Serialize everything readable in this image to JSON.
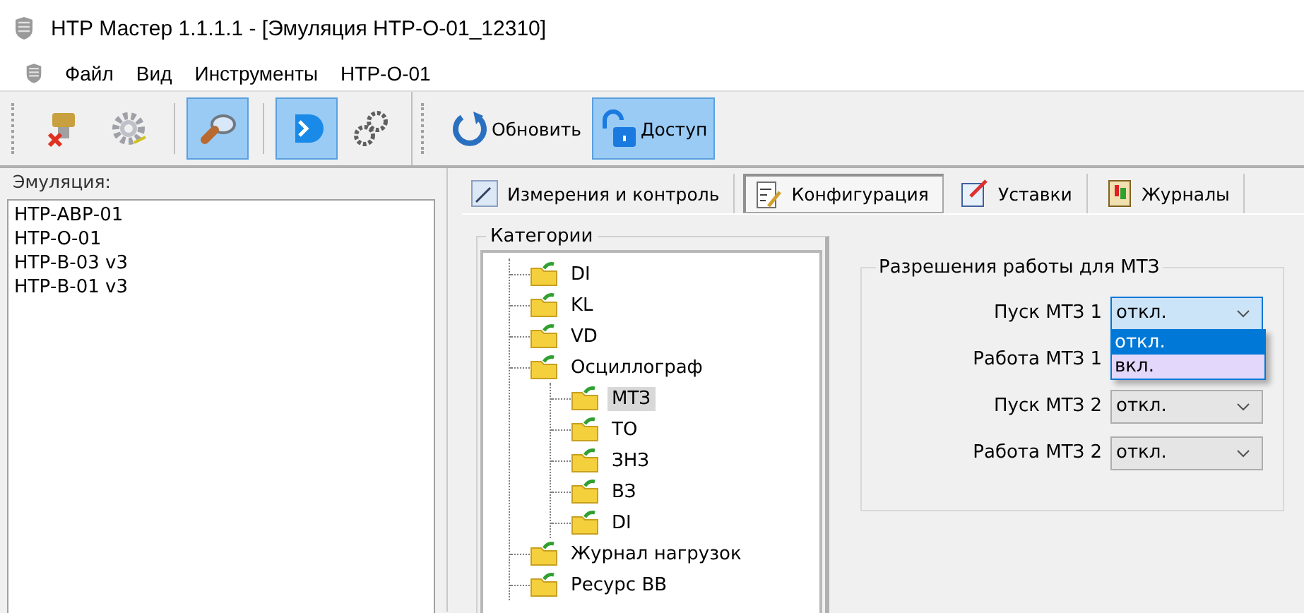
{
  "window": {
    "title": "НТР Мастер 1.1.1.1 - [Эмуляция НТР-О-01_12310]"
  },
  "menu": [
    "Файл",
    "Вид",
    "Инструменты",
    "НТР-О-01"
  ],
  "toolbar": [
    {
      "kind": "disconnect",
      "active": false
    },
    {
      "kind": "settings",
      "active": false
    },
    {
      "kind": "separator"
    },
    {
      "kind": "search",
      "active": true
    },
    {
      "kind": "separator"
    },
    {
      "kind": "device",
      "active": true
    },
    {
      "kind": "link",
      "active": false
    },
    {
      "kind": "grip"
    },
    {
      "kind": "refresh",
      "label": "Обновить",
      "active": false
    },
    {
      "kind": "lock",
      "label": "Доступ",
      "active": true
    }
  ],
  "emulation": {
    "title": "Эмуляция:",
    "items": [
      "НТР-АВР-01",
      "НТР-О-01",
      "НТР-В-03 v3",
      "НТР-В-01 v3"
    ]
  },
  "tabs": [
    {
      "label": "Измерения и контроль",
      "kind": "meter",
      "selected": false
    },
    {
      "label": "Конфигурация",
      "kind": "config",
      "selected": true
    },
    {
      "label": "Уставки",
      "kind": "edit",
      "selected": false
    },
    {
      "label": "Журналы",
      "kind": "journal",
      "selected": false
    }
  ],
  "categories": {
    "title": "Категории",
    "items": [
      {
        "label": "DI",
        "selected": false
      },
      {
        "label": "KL",
        "selected": false
      },
      {
        "label": "VD",
        "selected": false
      },
      {
        "label": "Осциллограф",
        "selected": false,
        "children": [
          {
            "label": "МТЗ",
            "selected": true
          },
          {
            "label": "ТО",
            "selected": false
          },
          {
            "label": "ЗНЗ",
            "selected": false
          },
          {
            "label": "ВЗ",
            "selected": false
          },
          {
            "label": "DI",
            "selected": false
          }
        ]
      },
      {
        "label": "Журнал нагрузок",
        "selected": false
      },
      {
        "label": "Ресурс ВВ",
        "selected": false
      }
    ]
  },
  "permissions": {
    "title": "Разрешения работы для МТЗ",
    "rows": [
      {
        "label": "Пуск МТЗ 1",
        "value": "откл.",
        "focused": true,
        "options": [
          {
            "label": "откл.",
            "selected": true,
            "hovered": false
          },
          {
            "label": "вкл.",
            "selected": false,
            "hovered": true
          }
        ]
      },
      {
        "label": "Работа МТЗ 1"
      },
      {
        "label": "Пуск МТЗ 2",
        "value": "откл.",
        "focused": false
      },
      {
        "label": "Работа МТЗ 2",
        "value": "откл.",
        "focused": false
      }
    ]
  }
}
